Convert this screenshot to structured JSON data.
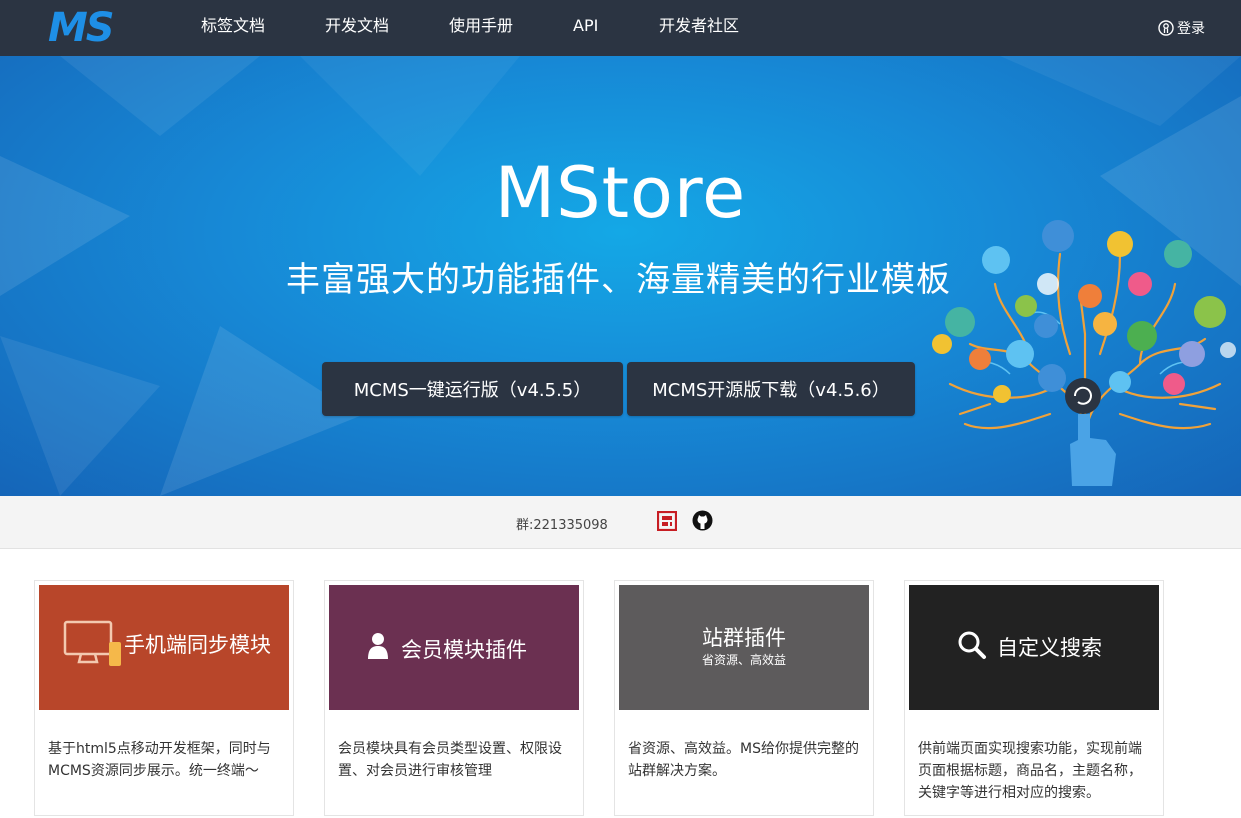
{
  "nav": {
    "logo_text": "MS",
    "items": [
      "标签文档",
      "开发文档",
      "使用手册",
      "API",
      "开发者社区"
    ],
    "login_label": "登录"
  },
  "hero": {
    "title": "MStore",
    "subtitle": "丰富强大的功能插件、海量精美的行业模板",
    "buttons": [
      "MCMS一键运行版（v4.5.5）",
      "MCMS开源版下载（v4.5.6）"
    ]
  },
  "community": {
    "qq_group": "群:221335098",
    "icons": [
      "gitee-icon",
      "github-icon"
    ]
  },
  "cards": [
    {
      "title": "手机端同步模块",
      "subtitle": "",
      "icon": "monitor-phone-icon",
      "color": "#b8462a",
      "desc": "基于html5点移动开发框架，同时与MCMS资源同步展示。统一终端～"
    },
    {
      "title": "会员模块插件",
      "subtitle": "",
      "icon": "user-icon",
      "color": "#6b3051",
      "desc": "会员模块具有会员类型设置、权限设置、对会员进行审核管理"
    },
    {
      "title": "站群插件",
      "subtitle": "省资源、高效益",
      "icon": "",
      "color": "#5d5b5c",
      "desc": "省资源、高效益。MS给你提供完整的站群解决方案。"
    },
    {
      "title": "自定义搜索",
      "subtitle": "",
      "icon": "search-icon",
      "color": "#222222",
      "desc": "供前端页面实现搜索功能，实现前端页面根据标题，商品名，主题名称，关键字等进行相对应的搜索。"
    }
  ],
  "colors": {
    "navbar": "#2b3442",
    "hero_blue": "#1789d6",
    "button_dark": "#2b3442",
    "logo_blue": "#1e8fe6"
  }
}
